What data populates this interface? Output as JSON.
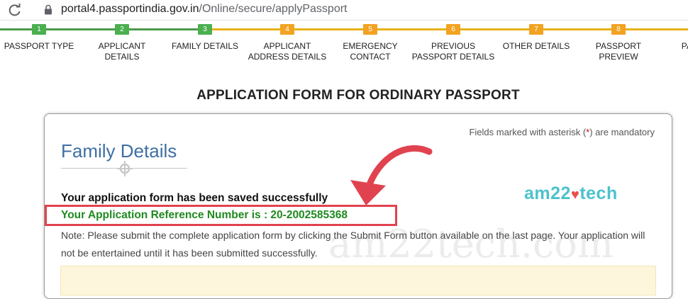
{
  "browser": {
    "url_host": "portal4.passportindia.gov.in",
    "url_path": "/Online/secure/applyPassport"
  },
  "steps": [
    {
      "number": "1",
      "label": "PASSPORT TYPE",
      "status": "done"
    },
    {
      "number": "2",
      "label": "APPLICANT\nDETAILS",
      "status": "done"
    },
    {
      "number": "3",
      "label": "FAMILY DETAILS",
      "status": "done"
    },
    {
      "number": "4",
      "label": "APPLICANT\nADDRESS DETAILS",
      "status": "todo"
    },
    {
      "number": "5",
      "label": "EMERGENCY\nCONTACT",
      "status": "todo"
    },
    {
      "number": "6",
      "label": "PREVIOUS\nPASSPORT DETAILS",
      "status": "todo"
    },
    {
      "number": "7",
      "label": "OTHER DETAILS",
      "status": "todo"
    },
    {
      "number": "8",
      "label": "PASSPORT\nPREVIEW",
      "status": "todo"
    },
    {
      "number": "",
      "label": "PASSPO\nVER",
      "status": "todo"
    }
  ],
  "page_heading": "APPLICATION FORM FOR ORDINARY PASSPORT",
  "panel": {
    "mandatory_prefix": "Fields marked with asterisk (",
    "mandatory_asterisk": "*",
    "mandatory_suffix": ") are mandatory",
    "section_title": "Family Details",
    "saved_message": "Your application form has been saved successfully",
    "reference_message": "Your Application Reference Number is : 20-2002585368",
    "note": "Note: Please submit the complete application form by clicking the Submit Form button available on the last page. Your application will not be entertained until it has been submitted successfully."
  },
  "overlay": {
    "logo_left": "am22",
    "logo_heart": "♥",
    "logo_right": "tech",
    "watermark": "am22tech.com"
  },
  "colors": {
    "step_done": "#4caf50",
    "step_todo": "#f2a322",
    "title_blue": "#3e6fa3",
    "reference_green": "#1f8a1f",
    "highlight_red": "#e0434f"
  }
}
